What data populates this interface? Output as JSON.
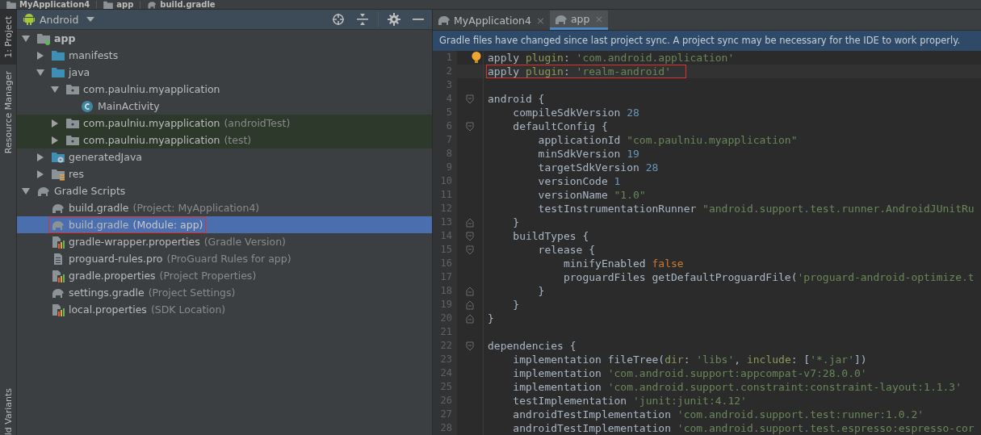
{
  "breadcrumb": [
    {
      "label": "MyApplication4",
      "kind": "module"
    },
    {
      "label": "app",
      "kind": "module"
    },
    {
      "label": "build.gradle",
      "kind": "gradle"
    }
  ],
  "side_strip": [
    {
      "label": "1: Project",
      "selected": true
    },
    {
      "label": "Resource Manager",
      "selected": false
    },
    {
      "label": "ld Variants",
      "selected": false
    }
  ],
  "project_panel": {
    "view": "Android",
    "tree": [
      {
        "label": "app",
        "kind": "module",
        "expanded": true,
        "selected": false,
        "children": [
          {
            "label": "manifests",
            "kind": "folder",
            "expanded": false,
            "selected": false
          },
          {
            "label": "java",
            "kind": "folder",
            "expanded": true,
            "selected": false,
            "children": [
              {
                "label": "com.paulniu.myapplication",
                "kind": "package",
                "expanded": true,
                "selected": false,
                "children": [
                  {
                    "label": "MainActivity",
                    "kind": "class",
                    "selected": false
                  }
                ]
              },
              {
                "label": "com.paulniu.myapplication",
                "note": "(androidTest)",
                "kind": "package",
                "expanded": false,
                "selected": false,
                "tinted": true
              },
              {
                "label": "com.paulniu.myapplication",
                "note": "(test)",
                "kind": "package",
                "expanded": false,
                "selected": false,
                "tinted": true
              }
            ]
          },
          {
            "label": "generatedJava",
            "kind": "generated",
            "expanded": false,
            "selected": false
          },
          {
            "label": "res",
            "kind": "res",
            "expanded": false,
            "selected": false
          }
        ]
      },
      {
        "label": "Gradle Scripts",
        "kind": "gradle",
        "expanded": true,
        "selected": false,
        "children": [
          {
            "label": "build.gradle",
            "note": "(Project: MyApplication4)",
            "kind": "gradle",
            "selected": false
          },
          {
            "label": "build.gradle",
            "note": "(Module: app)",
            "kind": "gradle",
            "selected": true,
            "boxed": true
          },
          {
            "label": "gradle-wrapper.properties",
            "note": "(Gradle Version)",
            "kind": "properties",
            "selected": false
          },
          {
            "label": "proguard-rules.pro",
            "note": "(ProGuard Rules for app)",
            "kind": "file",
            "selected": false
          },
          {
            "label": "gradle.properties",
            "note": "(Project Properties)",
            "kind": "properties",
            "selected": false
          },
          {
            "label": "settings.gradle",
            "note": "(Project Settings)",
            "kind": "gradle",
            "selected": false
          },
          {
            "label": "local.properties",
            "note": "(SDK Location)",
            "kind": "properties",
            "selected": false
          }
        ]
      }
    ]
  },
  "editor": {
    "tabs": [
      {
        "label": "MyApplication4",
        "close": "×",
        "selected": false
      },
      {
        "label": "app",
        "close": "×",
        "selected": true
      }
    ],
    "banner": "Gradle files have changed since last project sync. A project sync may be necessary for the IDE to work properly.",
    "lines": [
      {
        "number": "1",
        "bulb": true,
        "tokens": [
          {
            "text": "apply ",
            "kind": "plain"
          },
          {
            "text": "plugin",
            "kind": "label"
          },
          {
            "text": ": ",
            "kind": "plain"
          },
          {
            "text": "'com.android.application'",
            "kind": "string"
          }
        ]
      },
      {
        "number": "2",
        "boxed": true,
        "current": true,
        "tokens": [
          {
            "text": "apply ",
            "kind": "plain"
          },
          {
            "text": "plugin",
            "kind": "label"
          },
          {
            "text": ": ",
            "kind": "plain"
          },
          {
            "text": "'realm-android'",
            "kind": "string"
          }
        ]
      },
      {
        "number": "3"
      },
      {
        "number": "4",
        "kind": "block-start",
        "tokens": [
          {
            "text": "android {",
            "kind": "plain"
          }
        ]
      },
      {
        "number": "5",
        "tokens": [
          {
            "text": "    compileSdkVersion ",
            "kind": "plain"
          },
          {
            "text": "28",
            "kind": "number"
          }
        ]
      },
      {
        "number": "6",
        "kind": "block-start",
        "tokens": [
          {
            "text": "    defaultConfig {",
            "kind": "plain"
          }
        ]
      },
      {
        "number": "7",
        "tokens": [
          {
            "text": "        applicationId ",
            "kind": "plain"
          },
          {
            "text": "\"com.paulniu.myapplication\"",
            "kind": "string"
          }
        ]
      },
      {
        "number": "8",
        "tokens": [
          {
            "text": "        minSdkVersion ",
            "kind": "plain"
          },
          {
            "text": "19",
            "kind": "number"
          }
        ]
      },
      {
        "number": "9",
        "tokens": [
          {
            "text": "        targetSdkVersion ",
            "kind": "plain"
          },
          {
            "text": "28",
            "kind": "number"
          }
        ]
      },
      {
        "number": "10",
        "tokens": [
          {
            "text": "        versionCode ",
            "kind": "plain"
          },
          {
            "text": "1",
            "kind": "number"
          }
        ]
      },
      {
        "number": "11",
        "tokens": [
          {
            "text": "        versionName ",
            "kind": "plain"
          },
          {
            "text": "\"1.0\"",
            "kind": "string"
          }
        ]
      },
      {
        "number": "12",
        "tokens": [
          {
            "text": "        testInstrumentationRunner ",
            "kind": "plain"
          },
          {
            "text": "\"android.support.test.runner.AndroidJUnitRu",
            "kind": "string"
          }
        ]
      },
      {
        "number": "13",
        "kind": "block-end",
        "tokens": [
          {
            "text": "    }",
            "kind": "plain"
          }
        ]
      },
      {
        "number": "14",
        "kind": "block-start",
        "tokens": [
          {
            "text": "    buildTypes {",
            "kind": "plain"
          }
        ]
      },
      {
        "number": "15",
        "kind": "block-start",
        "tokens": [
          {
            "text": "        release {",
            "kind": "plain"
          }
        ]
      },
      {
        "number": "16",
        "tokens": [
          {
            "text": "            minifyEnabled ",
            "kind": "plain"
          },
          {
            "text": "false",
            "kind": "keyword"
          }
        ]
      },
      {
        "number": "17",
        "tokens": [
          {
            "text": "            proguardFiles getDefaultProguardFile(",
            "kind": "plain"
          },
          {
            "text": "'proguard-android-optimize.t",
            "kind": "string"
          }
        ]
      },
      {
        "number": "18",
        "kind": "block-end",
        "tokens": [
          {
            "text": "        }",
            "kind": "plain"
          }
        ]
      },
      {
        "number": "19",
        "kind": "block-end",
        "tokens": [
          {
            "text": "    }",
            "kind": "plain"
          }
        ]
      },
      {
        "number": "20",
        "kind": "block-end",
        "tokens": [
          {
            "text": "}",
            "kind": "plain"
          }
        ]
      },
      {
        "number": "21"
      },
      {
        "number": "22",
        "kind": "block-start",
        "tokens": [
          {
            "text": "dependencies {",
            "kind": "plain"
          }
        ]
      },
      {
        "number": "23",
        "tokens": [
          {
            "text": "    implementation fileTree(",
            "kind": "plain"
          },
          {
            "text": "dir",
            "kind": "label"
          },
          {
            "text": ": ",
            "kind": "plain"
          },
          {
            "text": "'libs'",
            "kind": "string"
          },
          {
            "text": ", ",
            "kind": "plain"
          },
          {
            "text": "include",
            "kind": "label"
          },
          {
            "text": ": [",
            "kind": "plain"
          },
          {
            "text": "'*.jar'",
            "kind": "string"
          },
          {
            "text": "])",
            "kind": "plain"
          }
        ]
      },
      {
        "number": "24",
        "tokens": [
          {
            "text": "    implementation ",
            "kind": "plain"
          },
          {
            "text": "'com.android.support:appcompat-v7:28.0.0'",
            "kind": "string"
          }
        ]
      },
      {
        "number": "25",
        "tokens": [
          {
            "text": "    implementation ",
            "kind": "plain"
          },
          {
            "text": "'com.android.support.constraint:constraint-layout:1.1.3'",
            "kind": "string"
          }
        ]
      },
      {
        "number": "26",
        "tokens": [
          {
            "text": "    testImplementation ",
            "kind": "plain"
          },
          {
            "text": "'junit:junit:4.12'",
            "kind": "string"
          }
        ]
      },
      {
        "number": "27",
        "tokens": [
          {
            "text": "    androidTestImplementation ",
            "kind": "plain"
          },
          {
            "text": "'com.android.support.test:runner:1.0.2'",
            "kind": "string"
          }
        ]
      },
      {
        "number": "28",
        "tokens": [
          {
            "text": "    androidTestImplementation ",
            "kind": "plain"
          },
          {
            "text": "'com.android.support.test.espresso:espresso-cor",
            "kind": "string"
          }
        ]
      }
    ]
  }
}
